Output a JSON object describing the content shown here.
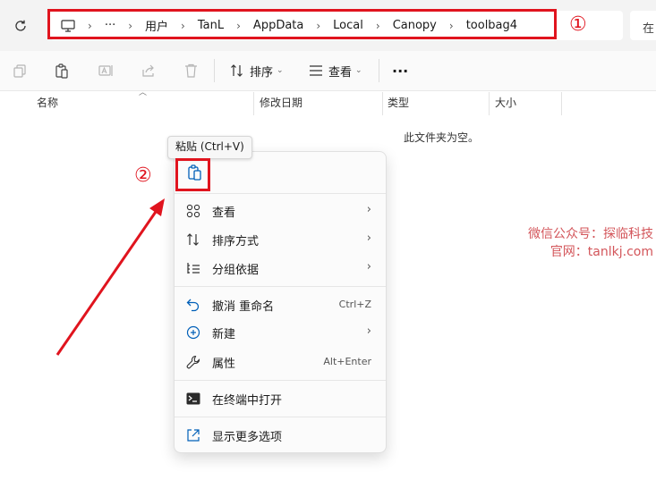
{
  "addressbar": {
    "crumbs": [
      "用户",
      "TanL",
      "AppData",
      "Local",
      "Canopy",
      "toolbag4"
    ],
    "more": "···",
    "search_placeholder": "在"
  },
  "annotations": {
    "marker1": "①",
    "marker2": "②"
  },
  "toolbar": {
    "sort_label": "排序",
    "view_label": "查看",
    "more_label": "···"
  },
  "columns": {
    "name": "名称",
    "modified": "修改日期",
    "type": "类型",
    "size": "大小"
  },
  "empty_text": "此文件夹为空。",
  "watermark": {
    "line1": "微信公众号：探临科技",
    "line2": "官网：tanlkj.com"
  },
  "tooltip": "粘贴 (Ctrl+V)",
  "menu": {
    "paste_icon": "paste-icon",
    "items": [
      {
        "icon": "grid-icon",
        "label": "查看",
        "arrow": "›"
      },
      {
        "icon": "sort-icon",
        "label": "排序方式",
        "arrow": "›"
      },
      {
        "icon": "group-icon",
        "label": "分组依据",
        "arrow": "›"
      },
      {
        "icon": "undo-icon",
        "label": "撤消 重命名",
        "shortcut": "Ctrl+Z"
      },
      {
        "icon": "new-icon",
        "label": "新建",
        "arrow": "›"
      },
      {
        "icon": "wrench-icon",
        "label": "属性",
        "shortcut": "Alt+Enter"
      },
      {
        "icon": "terminal-icon",
        "label": "在终端中打开"
      },
      {
        "icon": "show-more-icon",
        "label": "显示更多选项"
      }
    ]
  },
  "colors": {
    "accent": "#005fb8",
    "annotation_red": "#e0141e",
    "watermark": "#d3555a"
  }
}
